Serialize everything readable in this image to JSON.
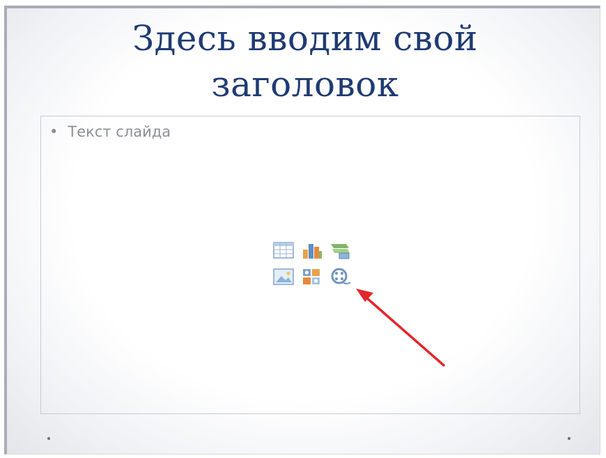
{
  "slide": {
    "title_line1": "Здесь вводим свой",
    "title_line2": "заголовок",
    "bullet_marker": "•",
    "body_text": "Текст слайда"
  },
  "content_icons": [
    {
      "name": "insert-table-icon"
    },
    {
      "name": "insert-chart-icon"
    },
    {
      "name": "insert-smartart-icon"
    },
    {
      "name": "insert-picture-icon"
    },
    {
      "name": "insert-clipart-icon"
    },
    {
      "name": "insert-media-icon"
    }
  ],
  "colors": {
    "title": "#1f3b73",
    "body_text": "#8d8f95",
    "arrow": "#e3262a",
    "frame_border": "#a9acb8"
  }
}
